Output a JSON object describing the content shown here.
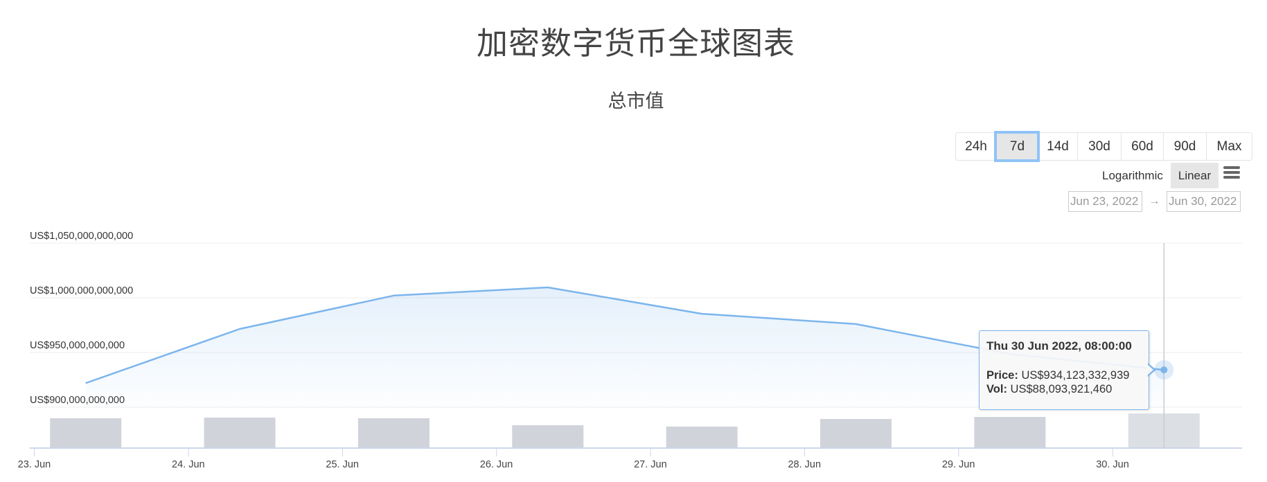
{
  "header": {
    "title": "加密数字货币全球图表",
    "subtitle": "总市值"
  },
  "controls": {
    "ranges": [
      {
        "label": "24h",
        "active": false
      },
      {
        "label": "7d",
        "active": true
      },
      {
        "label": "14d",
        "active": false
      },
      {
        "label": "30d",
        "active": false
      },
      {
        "label": "60d",
        "active": false
      },
      {
        "label": "90d",
        "active": false
      },
      {
        "label": "Max",
        "active": false
      }
    ],
    "scale": {
      "logarithmic_label": "Logarithmic",
      "linear_label": "Linear",
      "selected": "Linear"
    },
    "menu_icon": "hamburger-menu-icon",
    "date_from": "Jun 23, 2022",
    "date_arrow": "→",
    "date_to": "Jun 30, 2022"
  },
  "tooltip": {
    "date": "Thu 30 Jun 2022, 08:00:00",
    "price_label": "Price:",
    "price_value": "US$934,123,332,939",
    "vol_label": "Vol:",
    "vol_value": "US$88,093,921,460"
  },
  "colors": {
    "line": "#7cb5ec",
    "area_top": "#e3eefb",
    "bar": "#d0d3da",
    "bar_hover": "#dcdfe4",
    "grid": "#eeeeee",
    "axis": "#ccd6eb",
    "tooltip_border": "#7cb5ec"
  },
  "chart_data": {
    "type": "line",
    "title": "总市值",
    "xlabel": "",
    "ylabel": "",
    "x_ticks": [
      "23. Jun",
      "24. Jun",
      "25. Jun",
      "26. Jun",
      "27. Jun",
      "28. Jun",
      "29. Jun",
      "30. Jun"
    ],
    "x_tick_days": [
      23,
      24,
      25,
      26,
      27,
      28,
      29,
      30
    ],
    "x_range_days": [
      22.97,
      30.84
    ],
    "y_ticks": [
      900000000000,
      950000000000,
      1000000000000,
      1050000000000
    ],
    "y_tick_labels": [
      "US$900,000,000,000",
      "US$950,000,000,000",
      "US$1,000,000,000,000",
      "US$1,050,000,000,000"
    ],
    "ylim": [
      900000000000,
      1050000000000
    ],
    "grid": true,
    "x": [
      "2022-06-23 08:00",
      "2022-06-24 08:00",
      "2022-06-25 08:00",
      "2022-06-26 08:00",
      "2022-06-27 08:00",
      "2022-06-28 08:00",
      "2022-06-29 08:00",
      "2022-06-30 08:00"
    ],
    "x_days": [
      23.333,
      24.333,
      25.333,
      26.333,
      27.333,
      28.333,
      29.333,
      30.333
    ],
    "series": [
      {
        "name": "Price",
        "kind": "area-line",
        "values": [
          922000000000,
          971500000000,
          1002000000000,
          1009500000000,
          985400000000,
          976000000000,
          948700000000,
          934123332939
        ]
      },
      {
        "name": "Vol",
        "kind": "bar",
        "values": [
          75800000000,
          77500000000,
          75800000000,
          58100000000,
          54600000000,
          74000000000,
          79300000000,
          88093921460
        ]
      }
    ],
    "highlighted_index": 7,
    "legend": "none"
  }
}
